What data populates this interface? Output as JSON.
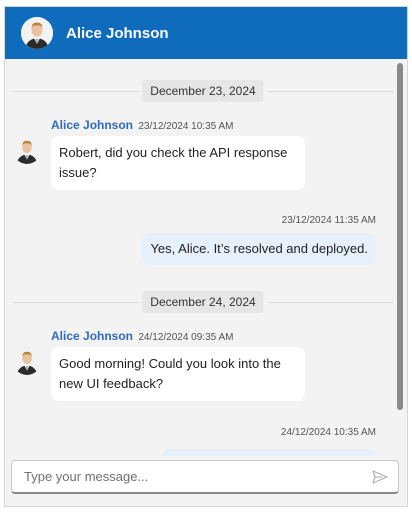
{
  "header": {
    "title": "Alice Johnson",
    "avatar_icon": "user-avatar-icon"
  },
  "theme": {
    "header_bg": "#0f6cbd",
    "outgoing_bubble": "#e6f0fb",
    "incoming_bubble": "#ffffff",
    "author_color": "#2f6bbd"
  },
  "conversation": {
    "separators": [
      {
        "label": "December 23, 2024"
      },
      {
        "label": "December 24, 2024"
      }
    ],
    "messages": [
      {
        "direction": "incoming",
        "author": "Alice Johnson",
        "time": "23/12/2024 10:35 AM",
        "text": "Robert, did you check the API response issue?"
      },
      {
        "direction": "outgoing",
        "time": "23/12/2024 11:35 AM",
        "text": "Yes, Alice. It’s resolved and deployed."
      },
      {
        "direction": "incoming",
        "author": "Alice Johnson",
        "time": "24/12/2024 09:35 AM",
        "text": "Good morning! Could you look into the new UI feedback?"
      },
      {
        "direction": "outgoing",
        "time": "24/12/2024 10:35 AM",
        "text": ""
      }
    ]
  },
  "composer": {
    "placeholder": "Type your message...",
    "value": "",
    "send_icon": "send-icon"
  }
}
